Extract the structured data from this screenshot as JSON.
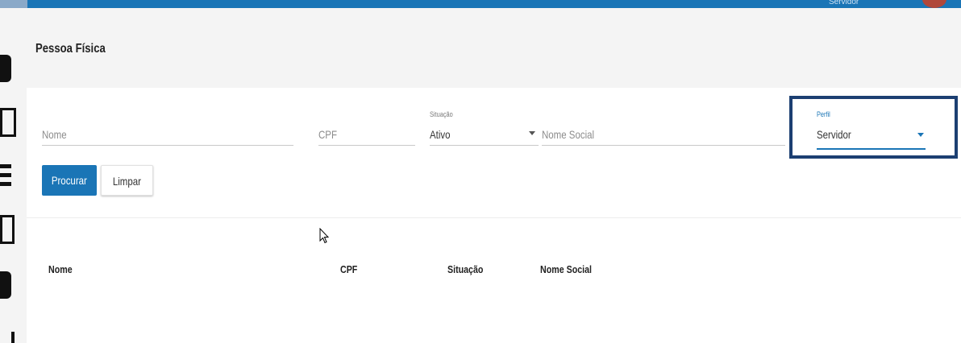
{
  "header": {
    "user_label": "Servidor",
    "accent": "#1a75b6"
  },
  "page": {
    "title": "Pessoa Física"
  },
  "filters": {
    "nome": {
      "placeholder": "Nome"
    },
    "cpf": {
      "placeholder": "CPF"
    },
    "situacao": {
      "label": "Situação",
      "value": "Ativo"
    },
    "nome_social": {
      "placeholder": "Nome Social"
    },
    "perfil": {
      "label": "Perfil",
      "value": "Servidor",
      "highlight_color": "#1c3f72"
    }
  },
  "actions": {
    "search_label": "Procurar",
    "clear_label": "Limpar"
  },
  "results": {
    "columns": [
      "Nome",
      "CPF",
      "Situação",
      "Nome Social"
    ],
    "rows": []
  }
}
